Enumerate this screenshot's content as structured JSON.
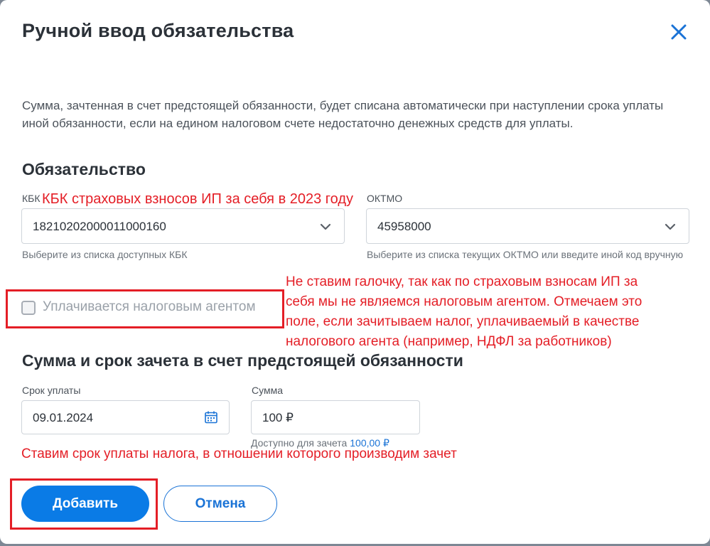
{
  "dialog": {
    "title": "Ручной ввод обязательства",
    "intro": "Сумма, зачтенная в счет предстоящей обязанности, будет списана автоматически при наступлении срока уплаты иной обязанности, если на едином налоговом счете недостаточно денежных средств для уплаты."
  },
  "obligation": {
    "section_title": "Обязательство",
    "kbk": {
      "label": "КБК",
      "value": "18210202000011000160",
      "hint": "Выберите из списка доступных КБК"
    },
    "oktmo": {
      "label": "ОКТМО",
      "value": "45958000",
      "hint": "Выберите из списка текущих ОКТМО или введите иной код вручную"
    },
    "agent_checkbox": {
      "label": "Уплачивается налоговым агентом",
      "checked": false
    }
  },
  "offset": {
    "section_title": "Сумма и срок зачета в счет предстоящей обязанности",
    "due_date": {
      "label": "Срок уплаты",
      "value": "09.01.2024"
    },
    "amount": {
      "label": "Сумма",
      "value": "100 ₽"
    },
    "available_label": "Доступно для зачета",
    "available_amount": "100,00 ₽"
  },
  "buttons": {
    "add": "Добавить",
    "cancel": "Отмена"
  },
  "annotations": {
    "kbk_note": "КБК страховых взносов ИП за себя в 2023 году",
    "agent_note": [
      "Не ставим галочку, так как по страховым взносам ИП за",
      "себя мы не являемся налоговым агентом. Отмечаем это",
      "поле, если зачитываем налог, уплачиваемый в качестве",
      "налогового агента (например, НДФЛ за работников)"
    ],
    "date_note": "Ставим срок уплаты налога, в отношении которого производим зачет"
  },
  "colors": {
    "accent": "#0a7be6",
    "annotation": "#e41e26",
    "text": "#2b3138"
  },
  "icons": {
    "close": "close-icon",
    "chevron": "chevron-down-icon",
    "calendar": "calendar-icon"
  }
}
